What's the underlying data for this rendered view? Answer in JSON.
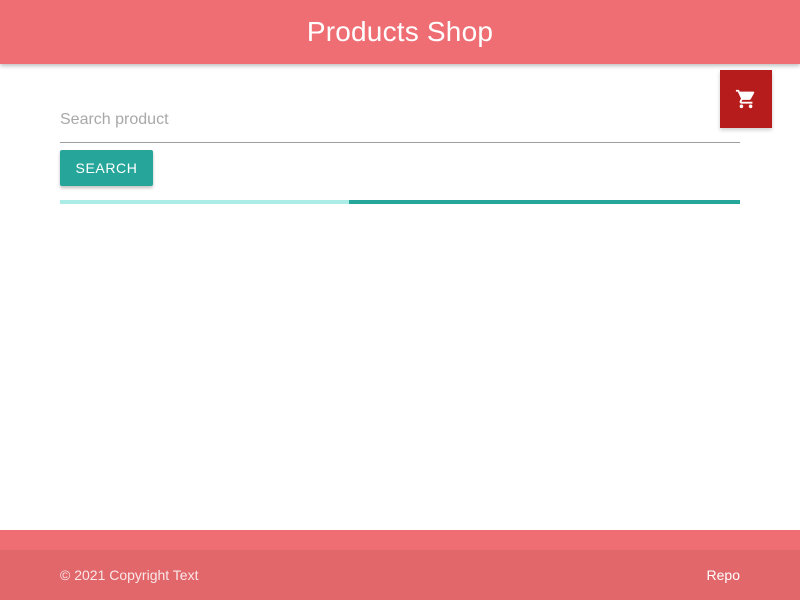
{
  "header": {
    "title": "Products Shop"
  },
  "cart": {
    "icon": "shopping-cart-icon"
  },
  "search": {
    "value": "",
    "placeholder": "Search product",
    "button_label": "Search"
  },
  "progress": {
    "indeterminate": true
  },
  "footer": {
    "copyright": "© 2021 Copyright Text",
    "link_label": "Repo"
  },
  "colors": {
    "navbar": "#ef6e73",
    "cart_button": "#b71c1c",
    "accent": "#26a69a",
    "progress_track": "#acece6",
    "footer_bottom": "#e1676b"
  }
}
